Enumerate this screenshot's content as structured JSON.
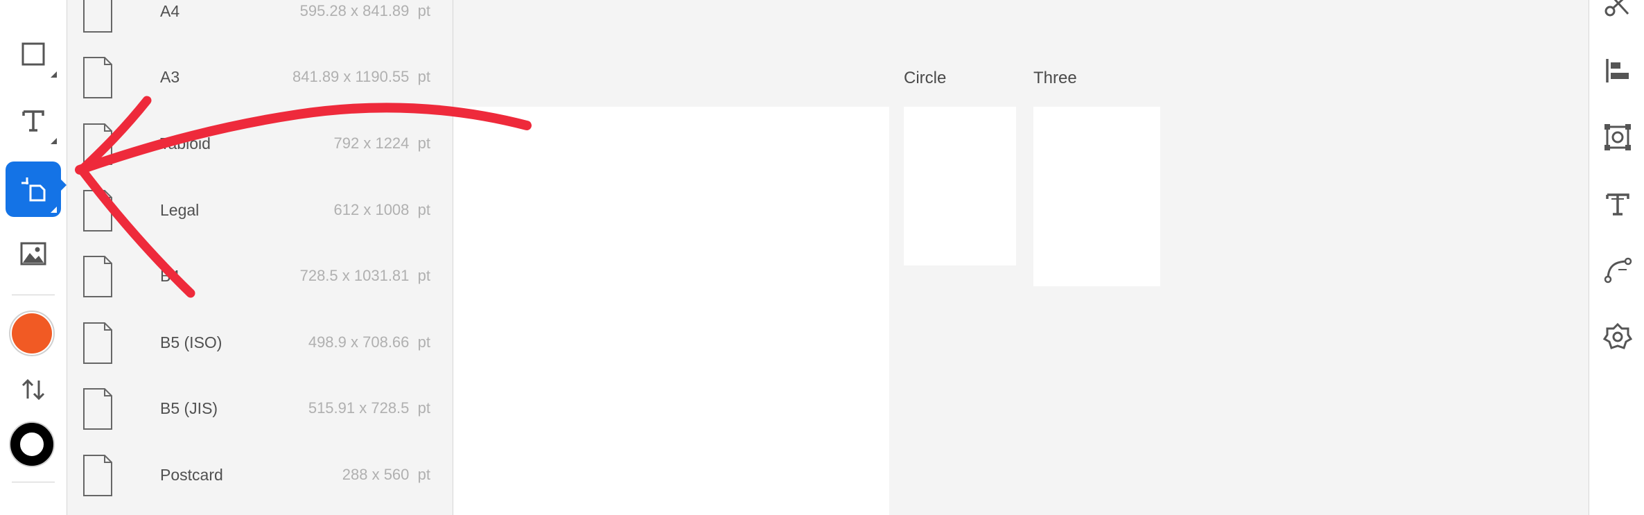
{
  "toolbar": {
    "tools": [
      {
        "name": "rectangle-tool",
        "icon": "rectangle-icon"
      },
      {
        "name": "text-tool",
        "icon": "text-icon"
      },
      {
        "name": "artboard-tool",
        "icon": "artboard-icon",
        "selected": true
      },
      {
        "name": "image-tool",
        "icon": "image-icon"
      }
    ],
    "fill_color": "#f15a24",
    "stroke_color": "#000000",
    "swap_icon": "swap-arrows-icon"
  },
  "presets": [
    {
      "name": "A4",
      "dims": "595.28 x 841.89",
      "unit": "pt"
    },
    {
      "name": "A3",
      "dims": "841.89 x 1190.55",
      "unit": "pt"
    },
    {
      "name": "Tabloid",
      "dims": "792 x 1224",
      "unit": "pt"
    },
    {
      "name": "Legal",
      "dims": "612 x 1008",
      "unit": "pt"
    },
    {
      "name": "B4",
      "dims": "728.5 x 1031.81",
      "unit": "pt"
    },
    {
      "name": "B5 (ISO)",
      "dims": "498.9 x 708.66",
      "unit": "pt"
    },
    {
      "name": "B5 (JIS)",
      "dims": "515.91 x 728.5",
      "unit": "pt"
    },
    {
      "name": "Postcard",
      "dims": "288 x 560",
      "unit": "pt"
    }
  ],
  "artboards": [
    {
      "label": "Circle"
    },
    {
      "label": "Three"
    }
  ],
  "right_toolbar": {
    "icons": [
      "scissors-icon",
      "align-left-icon",
      "transform-icon",
      "type-icon",
      "path-icon",
      "settings-icon"
    ]
  },
  "colors": {
    "accent": "#1473e6",
    "annotation": "#ee2a3b"
  }
}
